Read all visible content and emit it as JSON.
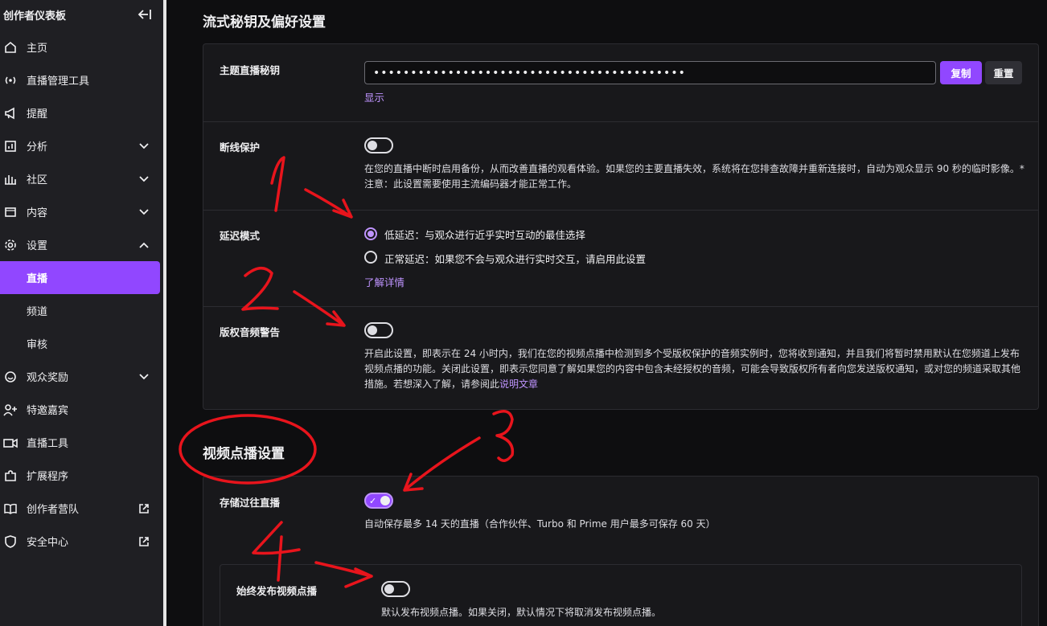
{
  "sidebar": {
    "title": "创作者仪表板",
    "collapse_icon": "collapse-left-icon",
    "items": [
      {
        "label": "主页",
        "icon": "home-icon"
      },
      {
        "label": "直播管理工具",
        "icon": "broadcast-icon"
      },
      {
        "label": "提醒",
        "icon": "megaphone-icon"
      },
      {
        "label": "分析",
        "icon": "analytics-icon"
      },
      {
        "label": "社区",
        "icon": "community-icon"
      },
      {
        "label": "内容",
        "icon": "content-icon"
      },
      {
        "label": "设置",
        "icon": "gear-icon"
      },
      {
        "label": "直播"
      },
      {
        "label": "频道"
      },
      {
        "label": "审核"
      },
      {
        "label": "观众奖励",
        "icon": "viewer-rewards-icon"
      },
      {
        "label": "特邀嘉宾",
        "icon": "add-user-icon"
      },
      {
        "label": "直播工具",
        "icon": "camera-icon"
      },
      {
        "label": "扩展程序",
        "icon": "puzzle-icon"
      },
      {
        "label": "创作者营队",
        "icon": "book-icon"
      },
      {
        "label": "安全中心",
        "icon": "shield-icon"
      }
    ]
  },
  "stream_key_section": {
    "title": "流式秘钥及偏好设置",
    "primary_key": {
      "label": "主题直播秘钥",
      "value": "••••••••••••••••••••••••••••••••••••••••••",
      "copy_label": "复制",
      "reset_label": "重置",
      "show_label": "显示"
    },
    "disconnect_protection": {
      "label": "断线保护",
      "enabled": false,
      "description": "在您的直播中断时启用备份，从而改善直播的观看体验。如果您的主要直播失效，系统将在您排查故障并重新连接时，自动为观众显示 90 秒的临时影像。* 注意：此设置需要使用主流编码器才能正常工作。"
    },
    "latency_mode": {
      "label": "延迟模式",
      "options": [
        {
          "label": "低延迟：与观众进行近乎实时互动的最佳选择",
          "selected": true
        },
        {
          "label": "正常延迟：如果您不会与观众进行实时交互，请启用此设置",
          "selected": false
        }
      ],
      "learn_more": "了解详情"
    },
    "copyright_audio": {
      "label": "版权音频警告",
      "enabled": false,
      "description": "开启此设置，即表示在 24 小时内，我们在您的视频点播中检测到多个受版权保护的音频实例时，您将收到通知，并且我们将暂时禁用默认在您频道上发布视频点播的功能。关闭此设置，即表示您同意了解如果您的内容中包含未经授权的音频，可能会导致版权所有者向您发送版权通知，或对您的频道采取其他措施。若想深入了解，请参阅此",
      "link": "说明文章"
    }
  },
  "vod_section": {
    "title": "视频点播设置",
    "store_past": {
      "label": "存储过往直播",
      "enabled": true,
      "description": "自动保存最多 14 天的直播（合作伙伴、Turbo 和 Prime 用户最多可保存 60 天）"
    },
    "always_publish": {
      "label": "始终发布视频点播",
      "enabled": false,
      "description": "默认发布视频点播。如果关闭，默认情况下将取消发布视频点播。"
    }
  },
  "colors": {
    "accent": "#9147ff",
    "accent_light": "#bf94ff",
    "annotation": "#e8141c",
    "background": "#0e0e10",
    "panel": "#18181b"
  }
}
